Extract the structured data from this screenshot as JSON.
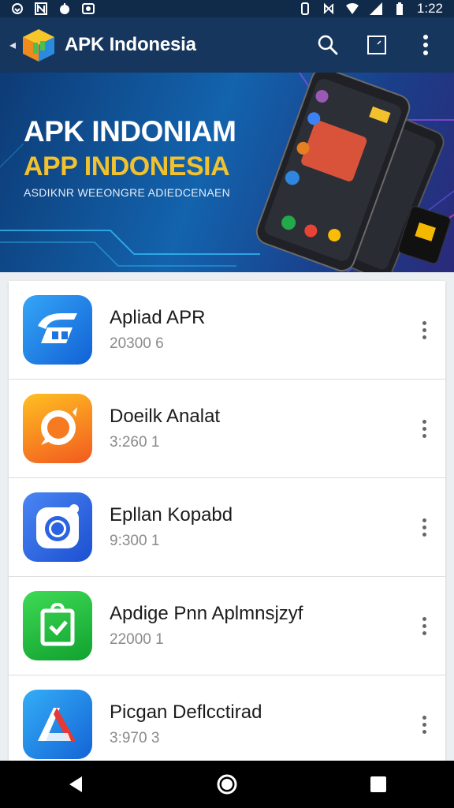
{
  "status_bar": {
    "time": "1:22",
    "left_icons": [
      "sync-icon",
      "n-icon",
      "apple-icon",
      "camera-icon"
    ],
    "right_icons": [
      "vibrate-icon",
      "nfc-icon",
      "wifi-icon",
      "signal-icon",
      "battery-icon"
    ]
  },
  "app_bar": {
    "title": "APK Indonesia",
    "actions": [
      "search-icon",
      "square-icon",
      "more-vert-icon"
    ]
  },
  "banner": {
    "title_line1": "APK INDONIAM",
    "title_line2": "APP INDONESIA",
    "subtitle": "ASDIKNR WEEONGRE ADIEDCENAEN"
  },
  "apps": [
    {
      "name": "Apliad APR",
      "meta": "20300 6",
      "icon": "fast-forward-app-icon",
      "color_a": "#2f9cf4",
      "color_b": "#1565d8"
    },
    {
      "name": "Doeilk Analat",
      "meta": "3:260 1",
      "icon": "chat-bubble-app-icon",
      "color_a": "#ffb21d",
      "color_b": "#f4511e"
    },
    {
      "name": "Epllan Kopabd",
      "meta": "9:300 1",
      "icon": "camera-app-icon",
      "color_a": "#3d7cf0",
      "color_b": "#1d4ed8"
    },
    {
      "name": "Apdige Pnn Aplmnsjzyf",
      "meta": "22000 1",
      "icon": "shopping-bag-app-icon",
      "color_a": "#35d04a",
      "color_b": "#12a531"
    },
    {
      "name": "Picgan Deflcctirad",
      "meta": "3:970 3",
      "icon": "triangle-app-icon",
      "color_a": "#2aa3f3",
      "color_b": "#1565d8"
    }
  ],
  "nav_bar": {
    "buttons": [
      "back-icon",
      "home-icon",
      "recents-icon"
    ]
  },
  "colors": {
    "status_bar": "#102a4a",
    "app_bar": "#16365e",
    "banner_accent": "#f2c12e"
  }
}
